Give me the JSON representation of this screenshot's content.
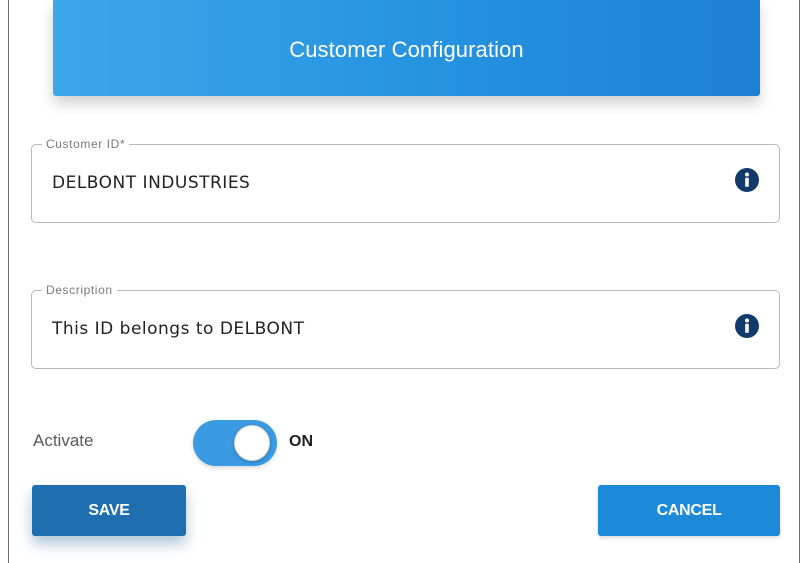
{
  "header": {
    "title": "Customer Configuration"
  },
  "customer_id": {
    "label": "Customer ID*",
    "value": "DELBONT INDUSTRIES"
  },
  "description": {
    "label": "Description",
    "value": "This ID belongs to DELBONT"
  },
  "activate": {
    "label": "Activate",
    "state": "ON",
    "on": true
  },
  "buttons": {
    "save": "SAVE",
    "cancel": "CANCEL"
  },
  "colors": {
    "header_gradient_start": "#3ca7ea",
    "header_gradient_end": "#1c80d4",
    "info_icon": "#0f3a6b",
    "toggle_on": "#3a9ae2",
    "save_button": "#1f6fb0",
    "cancel_button": "#1c8ad8"
  },
  "icons": {
    "info": "info-icon"
  }
}
